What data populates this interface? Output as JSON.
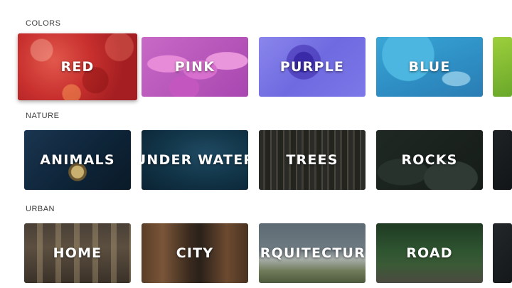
{
  "sections": [
    {
      "title": "COLORS",
      "tiles": [
        {
          "label": "RED",
          "icon": "red-leaves-image"
        },
        {
          "label": "PINK",
          "icon": "pink-tulips-image"
        },
        {
          "label": "PURPLE",
          "icon": "purple-flower-image"
        },
        {
          "label": "BLUE",
          "icon": "blue-water-image"
        },
        {
          "label": "",
          "icon": "green-image"
        }
      ]
    },
    {
      "title": "NATURE",
      "tiles": [
        {
          "label": "ANIMALS",
          "icon": "snail-image"
        },
        {
          "label": "UNDER WATER",
          "icon": "underwater-image"
        },
        {
          "label": "TREES",
          "icon": "forest-image"
        },
        {
          "label": "ROCKS",
          "icon": "rocks-image"
        },
        {
          "label": "",
          "icon": "dark-image"
        }
      ]
    },
    {
      "title": "URBAN",
      "tiles": [
        {
          "label": "HOME",
          "icon": "interior-image"
        },
        {
          "label": "CITY",
          "icon": "city-street-image"
        },
        {
          "label": "ARQUITECTURE",
          "icon": "architecture-image"
        },
        {
          "label": "ROAD",
          "icon": "railway-image"
        },
        {
          "label": "",
          "icon": "dark-image"
        }
      ]
    }
  ],
  "focused_tile": "RED",
  "colors": {
    "background": "#ffffff",
    "section_text": "#3c3c3c",
    "tile_text": "#ffffff"
  }
}
